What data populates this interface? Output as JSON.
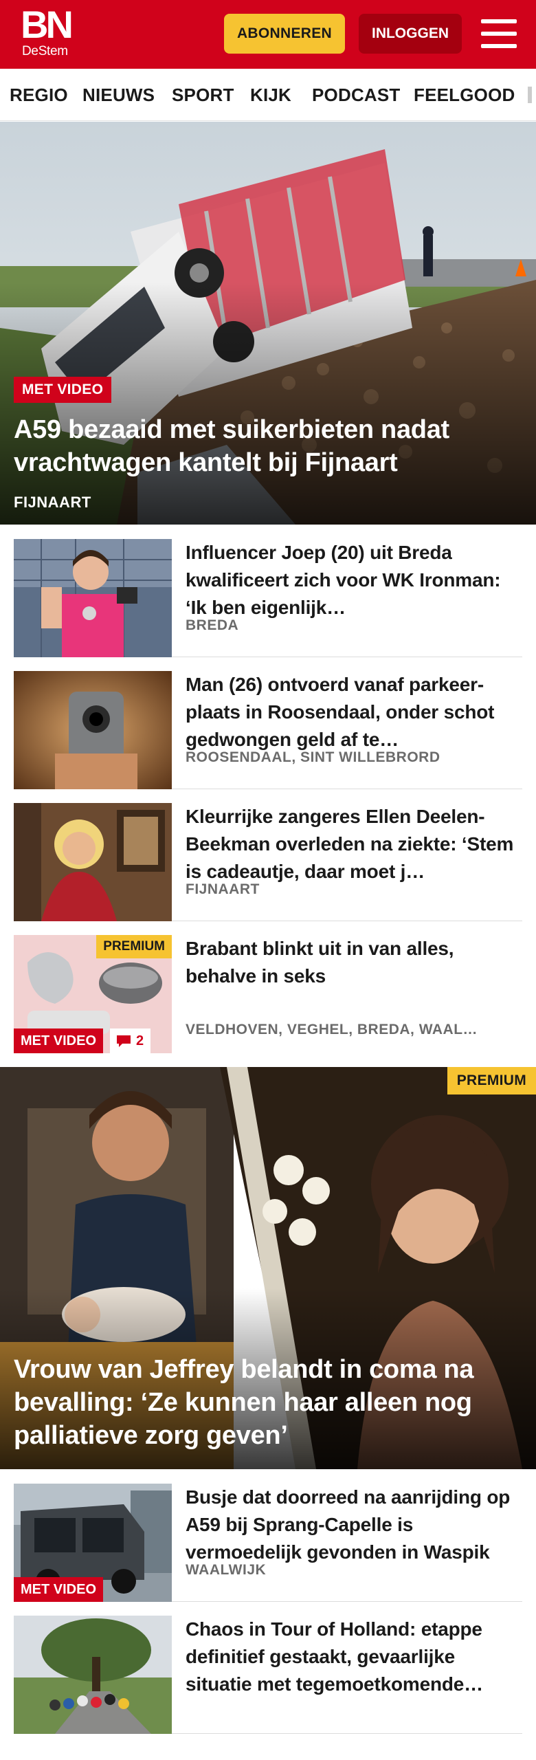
{
  "header": {
    "logo_main": "BN",
    "logo_sub": "DeStem",
    "subscribe_label": "ABONNEREN",
    "login_label": "INLOGGEN",
    "menu_icon": "hamburger-menu-icon",
    "brand_color": "#d0021b",
    "accent_color": "#f6c331"
  },
  "nav": {
    "items": [
      "REGIO",
      "NIEUWS",
      "SPORT",
      "KIJK",
      "PODCAST",
      "FEELGOOD"
    ]
  },
  "hero1": {
    "badge": "MET VIDEO",
    "title": "A59 bezaaid met suikerbieten nadat vrachtwagen kantelt bij Fijnaart",
    "location": "FIJNAART"
  },
  "list1": [
    {
      "title": "Influencer Joep (20) uit Breda kwalificeert zich voor WK Ironman: ‘Ik ben eigenlijk…",
      "location": "BREDA"
    },
    {
      "title": "Man (26) ontvoerd vanaf parkeer-plaats in Roosendaal, onder schot gedwongen geld af te…",
      "location": "ROOSENDAAL, SINT WILLEBRORD"
    },
    {
      "title": "Kleurrijke zangeres Ellen Deelen-Beekman overleden na ziekte: ‘Stem is cadeautje, daar moet j…",
      "location": "FIJNAART"
    },
    {
      "title": "Brabant blinkt uit in van alles, behalve in seks",
      "location": "VELDHOVEN, VEGHEL, BREDA, WAAL…",
      "premium": "PREMIUM",
      "video": "MET VIDEO",
      "comments": "2"
    }
  ],
  "hero2": {
    "premium": "PREMIUM",
    "title": "Vrouw van Jeffrey belandt in coma na bevalling: ‘Ze kunnen haar alleen nog palliatieve zorg geven’"
  },
  "list2": [
    {
      "title": "Busje dat doorreed na aanrijding op A59 bij Sprang-Capelle is vermoedelijk gevonden in Waspik",
      "location": "WAALWIJK",
      "video": "MET VIDEO"
    },
    {
      "title": "Chaos in Tour of Holland: etappe definitief gestaakt, gevaarlijke situatie met tegemoetkomende…",
      "location": ""
    }
  ]
}
